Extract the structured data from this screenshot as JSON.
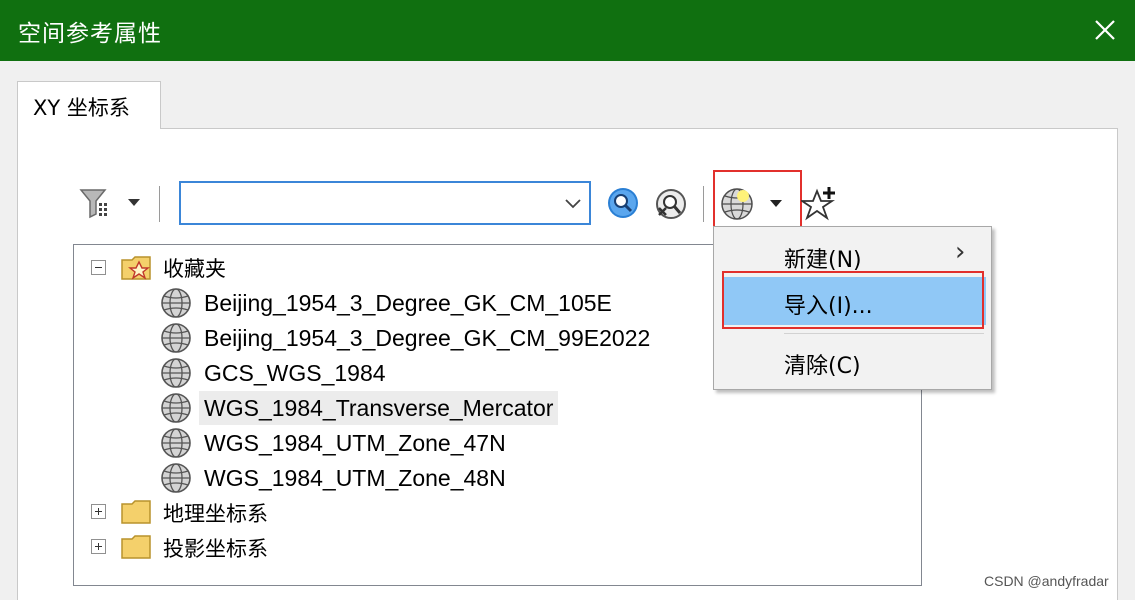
{
  "window": {
    "title": "空间参考属性",
    "close_label": "close"
  },
  "tabs": [
    {
      "label": "XY 坐标系",
      "active": true
    }
  ],
  "toolbar": {
    "filter_icon": "filter-icon",
    "search_input": {
      "value": "",
      "placeholder": ""
    },
    "search_button_icon": "magnifier-icon",
    "clear_search_icon": "clear-search-icon",
    "globe_menu_icon": "globe-icon",
    "add_favorite_icon": "star-add-icon"
  },
  "tree": {
    "favorites": {
      "label": "收藏夹",
      "expanded": true,
      "items": [
        "Beijing_1954_3_Degree_GK_CM_105E",
        "Beijing_1954_3_Degree_GK_CM_99E2022",
        "GCS_WGS_1984",
        "WGS_1984_Transverse_Mercator",
        "WGS_1984_UTM_Zone_47N",
        "WGS_1984_UTM_Zone_48N"
      ],
      "selected": "WGS_1984_Transverse_Mercator"
    },
    "geographic": {
      "label": "地理坐标系",
      "expanded": false
    },
    "projected": {
      "label": "投影坐标系",
      "expanded": false
    }
  },
  "menu": {
    "items": [
      {
        "label": "新建(N)",
        "has_submenu": true,
        "submenu_glyph": "›"
      },
      {
        "label": "导入(I)...",
        "highlighted": true
      },
      {
        "label": "清除(C)"
      }
    ]
  },
  "colors": {
    "titlebar": "#107010",
    "highlight": "#90c8f6",
    "annotation_red": "#e2302c",
    "input_border": "#3b86d8"
  },
  "watermark": "CSDN @andyfradar"
}
